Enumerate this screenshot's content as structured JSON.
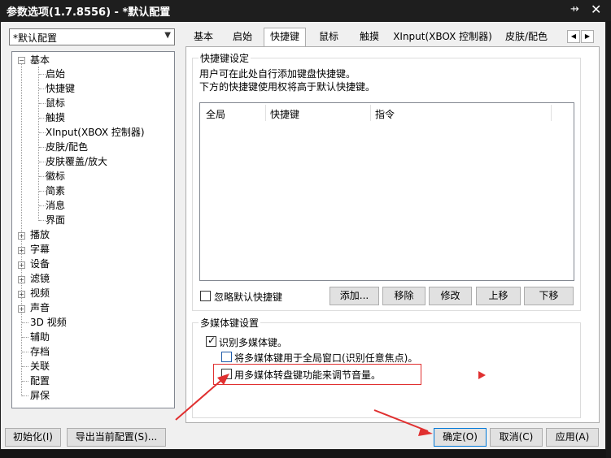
{
  "window": {
    "title": "参数选项(1.7.8556) - *默认配置",
    "pin_glyph": "⇸",
    "close_glyph": "✕"
  },
  "profile": {
    "selected": "*默认配置"
  },
  "tree": {
    "items": [
      {
        "label": "基本",
        "state": "expanded"
      },
      {
        "label": "启始",
        "level": 1
      },
      {
        "label": "快捷键",
        "level": 1
      },
      {
        "label": "鼠标",
        "level": 1
      },
      {
        "label": "触摸",
        "level": 1
      },
      {
        "label": "XInput(XBOX 控制器)",
        "level": 1
      },
      {
        "label": "皮肤/配色",
        "level": 1
      },
      {
        "label": "皮肤覆盖/放大",
        "level": 1
      },
      {
        "label": "徽标",
        "level": 1
      },
      {
        "label": "简素",
        "level": 1
      },
      {
        "label": "消息",
        "level": 1
      },
      {
        "label": "界面",
        "level": 1
      },
      {
        "label": "播放",
        "state": "collapsed"
      },
      {
        "label": "字幕",
        "state": "collapsed"
      },
      {
        "label": "设备",
        "state": "collapsed"
      },
      {
        "label": "滤镜",
        "state": "collapsed"
      },
      {
        "label": "视频",
        "state": "collapsed"
      },
      {
        "label": "声音",
        "state": "collapsed"
      },
      {
        "label": "3D 视频"
      },
      {
        "label": "辅助"
      },
      {
        "label": "存档"
      },
      {
        "label": "关联"
      },
      {
        "label": "配置"
      },
      {
        "label": "屏保"
      }
    ]
  },
  "tabs": [
    "基本",
    "启始",
    "快捷键",
    "鼠标",
    "触摸",
    "XInput(XBOX 控制器)",
    "皮肤/配色"
  ],
  "tab_scroll": {
    "left": "◀",
    "right": "▶"
  },
  "hotkey_group": {
    "title": "快捷键设定",
    "desc1": "用户可在此处自行添加键盘快捷键。",
    "desc2": "下方的快捷键使用权将高于默认快捷键。",
    "columns": [
      "全局",
      "快捷键",
      "指令"
    ],
    "ignore_default_label": "忽略默认快捷键",
    "buttons": {
      "add": "添加...",
      "remove": "移除",
      "modify": "修改",
      "up": "上移",
      "down": "下移"
    }
  },
  "media_group": {
    "title": "多媒体键设置",
    "recognize_label": "识别多媒体键。",
    "global_label": "将多媒体键用于全局窗口(识别任意焦点)。",
    "volume_label": "用多媒体转盘键功能来调节音量。"
  },
  "footer": {
    "reset": "初始化(I)",
    "export": "导出当前配置(S)...",
    "ok": "确定(O)",
    "cancel": "取消(C)",
    "apply": "应用(A)"
  },
  "colors": {
    "annotation_red": "#e03030",
    "title_bg": "#1e1e1e",
    "dialog_bg": "#f0f0f0"
  }
}
